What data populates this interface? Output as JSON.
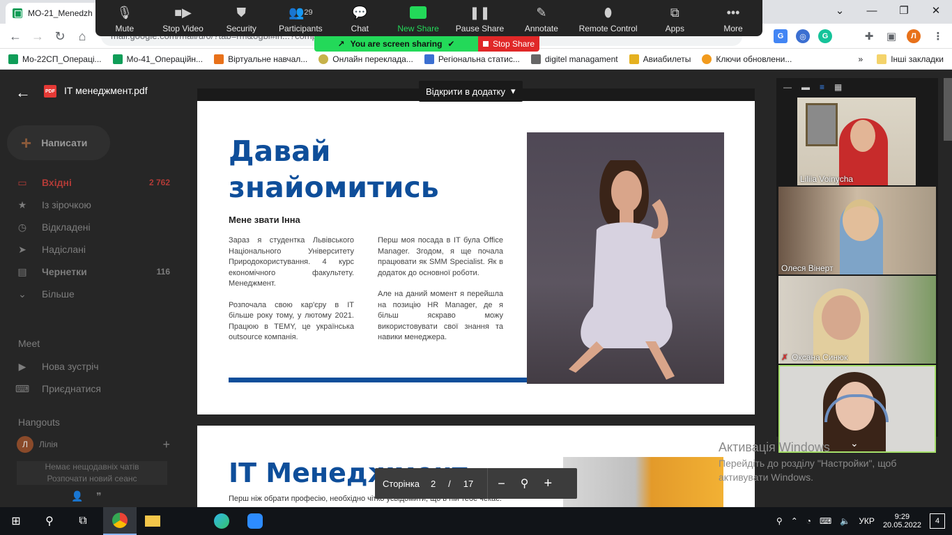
{
  "browser": {
    "tab_title": "МО-21_Menedzh",
    "url": "mail.google.com/mail/u/0/?tab=rm&ogbl#in...?compose=new&message_partId=0.1",
    "profile_initial": "Л"
  },
  "bookmarks": [
    {
      "label": "Мо-22СП_Операці...",
      "color": "#0f9d58"
    },
    {
      "label": "Мо-41_Операційн...",
      "color": "#0f9d58"
    },
    {
      "label": "Віртуальне навчал...",
      "color": "#e8711a"
    },
    {
      "label": "Онлайн переклада...",
      "color": "#c7b24a"
    },
    {
      "label": "Регіональна статис...",
      "color": "#3b6fd1"
    },
    {
      "label": "digitel managament",
      "color": "#666666"
    },
    {
      "label": "Авиабилеты",
      "color": "#e5b120"
    },
    {
      "label": "Ключи обновлени...",
      "color": "#f29b1d"
    }
  ],
  "bookmarks_other": "Інші закладки",
  "zoom_toolbar": {
    "mute": "Mute",
    "stop_video": "Stop Video",
    "security": "Security",
    "participants": "Participants",
    "participants_count": "29",
    "chat": "Chat",
    "new_share": "New Share",
    "pause_share": "Pause Share",
    "annotate": "Annotate",
    "remote_control": "Remote Control",
    "apps": "Apps",
    "more": "More",
    "sharing_text": "You are screen sharing",
    "stop_share": "Stop Share"
  },
  "viewer": {
    "file_name": "IT менеджмент.pdf",
    "file_badge": "PDF",
    "open_in_app": "Відкрити в додатку"
  },
  "gmail": {
    "compose": "Написати",
    "items": [
      {
        "label": "Вхідні",
        "count": "2 762"
      },
      {
        "label": "Із зірочкою",
        "count": ""
      },
      {
        "label": "Відкладені",
        "count": ""
      },
      {
        "label": "Надіслані",
        "count": ""
      },
      {
        "label": "Чернетки",
        "count": "116"
      },
      {
        "label": "Більше",
        "count": ""
      }
    ],
    "meet_title": "Meet",
    "meet_items": [
      "Нова зустріч",
      "Приєднатися"
    ],
    "hangouts_title": "Hangouts",
    "hangouts_user": "Лілія",
    "hangouts_user_initial": "Л",
    "no_chats": "Немає нещодавніх чатів",
    "new_session": "Розпочати новий сеанс"
  },
  "pdf": {
    "page1": {
      "title": "Давай знайомитись",
      "subtitle": "Мене звати Інна",
      "col1": [
        "Зараз я студентка Львівського Національного Університету Природокористування. 4 курс економічного факультету. Менеджмент.",
        "Розпочала свою кар'єру в IT більше року тому, у лютому 2021. Працюю в TEMY, це українська outsource компанія."
      ],
      "col2": [
        "Перш моя посада в IT була Office Manager. Згодом, я ще почала працювати як SMM Specialist. Як в додаток до основної роботи.",
        "Але на даний момент я перейшла на позицію HR Manager, де я більш яскраво можу використовувати свої знання та навики менеджера."
      ]
    },
    "page2": {
      "title": "IT Менеджмент",
      "text": "Перш ніж обрати професію, необхідно чітко усвідомити, що в ній тебе чекає."
    },
    "controls": {
      "page_label": "Сторінка",
      "current_page": "2",
      "separator": "/",
      "total_pages": "17"
    }
  },
  "participants": [
    {
      "name": "Liliia Voinycha",
      "muted": false
    },
    {
      "name": "Олеся Вінерт",
      "muted": false
    },
    {
      "name": "Оксана Синюк",
      "muted": true
    },
    {
      "name": "",
      "muted": false
    }
  ],
  "activation": {
    "title": "Активація Windows",
    "line1": "Перейдіть до розділу \"Настройки\", щоб",
    "line2": "активувати Windows."
  },
  "taskbar": {
    "language": "УКР",
    "time": "9:29",
    "date": "20.05.2022",
    "notifications": "4"
  }
}
